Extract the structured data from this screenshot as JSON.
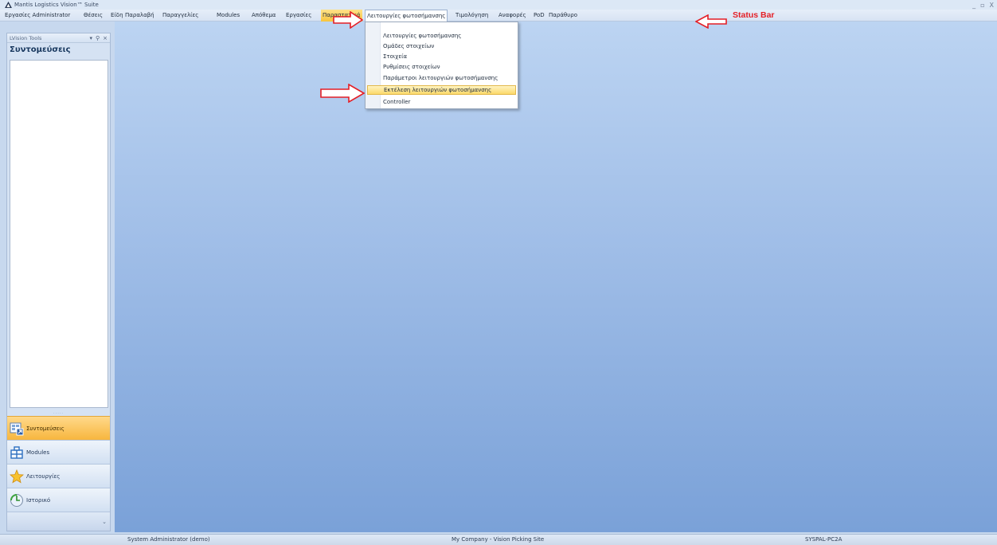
{
  "window": {
    "title": "Mantis Logistics Vision™ Suite",
    "controls": {
      "minimize": "_",
      "restore": "▫",
      "close": "X"
    }
  },
  "menubar": {
    "items": [
      {
        "label": "Εργασίες Administrator"
      },
      {
        "label": "Θέσεις"
      },
      {
        "label": "Είδη"
      },
      {
        "label": "Παραλαβή"
      },
      {
        "label": "Παραγγελίες"
      },
      {
        "label": "Modules"
      },
      {
        "label": "Απόθεμα"
      },
      {
        "label": "Εργασίες"
      },
      {
        "label": "Παραστατικά"
      },
      {
        "label": "Λειτουργίες φωτοσήμανσης"
      },
      {
        "label": "Τιμολόγηση"
      },
      {
        "label": "Αναφορές"
      },
      {
        "label": "PoD"
      },
      {
        "label": "Παράθυρο"
      }
    ]
  },
  "annotation": {
    "status_bar_label": "Status Bar"
  },
  "dropdown": {
    "items": [
      {
        "label": "Λειτουργίες φωτοσήμανσης"
      },
      {
        "label": "Ομάδες στοιχείων"
      },
      {
        "label": "Στοιχεία"
      },
      {
        "label": "Ρυθμίσεις στοιχείων"
      },
      {
        "label": "Παράμετροι λειτουργιών φωτοσήμανσης"
      },
      {
        "label": "Εκτέλεση λειτουργιών φωτοσήμανσης"
      },
      {
        "label": "Controller"
      }
    ],
    "selected_index": 5
  },
  "panel": {
    "header_title": "LVision Tools",
    "header_controls": {
      "dropdown": "▾",
      "pin": "⚲",
      "close": "×"
    },
    "subtitle": "Συντομεύσεις",
    "nav": [
      {
        "label": "Συντομεύσεις",
        "icon": "shortcuts-icon"
      },
      {
        "label": "Modules",
        "icon": "modules-icon"
      },
      {
        "label": "Λειτουργίες",
        "icon": "star-icon"
      },
      {
        "label": "Ιστορικό",
        "icon": "history-icon"
      }
    ],
    "splitter_grip": "·····",
    "footer_chevron": "⌄"
  },
  "statusbar": {
    "user": "System Administrator (demo)",
    "site": "My Company - Vision Picking Site",
    "machine": "SYSPAL-PC2A"
  },
  "colors": {
    "annotation_red": "#e41f26",
    "highlight_yellow": "#f7c43e",
    "workspace_top": "#bcd4f2",
    "workspace_bottom": "#7aa1d8"
  }
}
